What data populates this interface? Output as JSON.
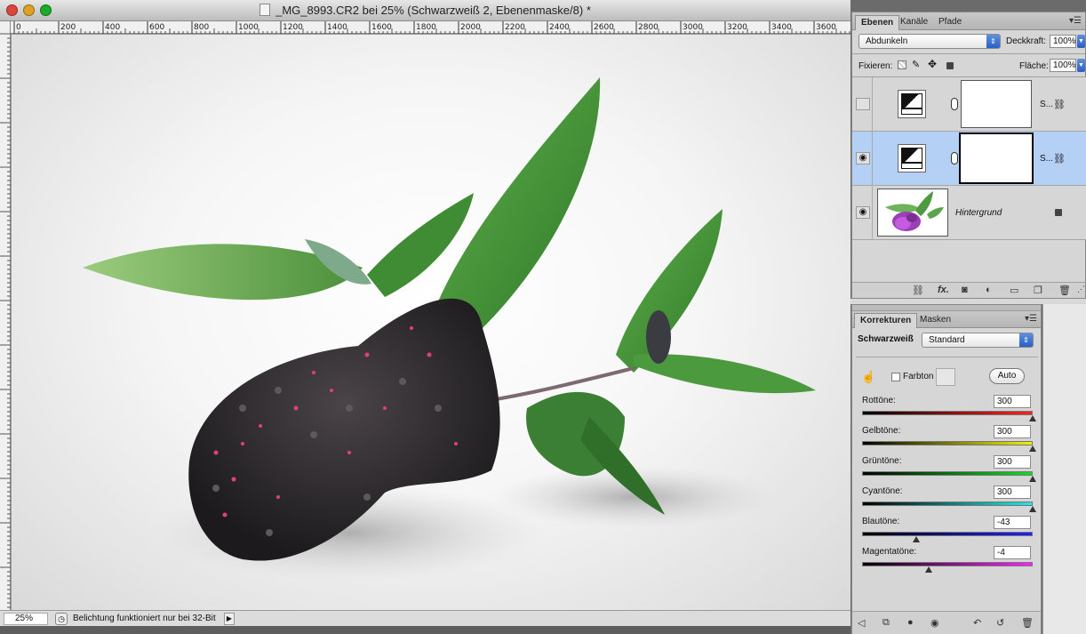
{
  "window": {
    "title": "_MG_8993.CR2 bei 25% (Schwarzweiß 2, Ebenenmaske/8) *",
    "traffic_light_colors": [
      "#e0443e",
      "#dea123",
      "#1aab29"
    ]
  },
  "ruler": {
    "h_labels": [
      "0",
      "200",
      "400",
      "600",
      "800",
      "1000",
      "1200",
      "1400",
      "1600",
      "1800",
      "2000",
      "2200",
      "2400",
      "2600",
      "2800",
      "3000",
      "3200",
      "3400",
      "3600"
    ]
  },
  "status": {
    "zoom": "25%",
    "text": "Belichtung funktioniert nur bei 32-Bit"
  },
  "layers_panel": {
    "tabs": [
      "Ebenen",
      "Kanäle",
      "Pfade"
    ],
    "blend_mode": "Abdunkeln",
    "opacity_label": "Deckkraft:",
    "opacity_value": "100%",
    "lock_label": "Fixieren:",
    "fill_label": "Fläche:",
    "fill_value": "100%",
    "layers": [
      {
        "name": "S...",
        "visible": false,
        "selected": false
      },
      {
        "name": "S...",
        "visible": true,
        "selected": true
      },
      {
        "name": "Hintergrund",
        "visible": true,
        "selected": false
      }
    ]
  },
  "adjustments_panel": {
    "tabs": [
      "Korrekturen",
      "Masken"
    ],
    "adjustment_name": "Schwarzweiß",
    "preset": "Standard",
    "tint_label": "Farbton",
    "auto_label": "Auto",
    "sliders": [
      {
        "label": "Rottöne:",
        "value": "300",
        "level": 1.0,
        "gradient": "#000000,#ff2020"
      },
      {
        "label": "Gelbtöne:",
        "value": "300",
        "level": 1.0,
        "gradient": "#000000,#f0f000"
      },
      {
        "label": "Grüntöne:",
        "value": "300",
        "level": 1.0,
        "gradient": "#000000,#10e020"
      },
      {
        "label": "Cyantöne:",
        "value": "300",
        "level": 1.0,
        "gradient": "#000000,#20e8e8"
      },
      {
        "label": "Blautöne:",
        "value": "-43",
        "level": 0.32,
        "gradient": "#000000,#2020ff"
      },
      {
        "label": "Magentatöne:",
        "value": "-4",
        "level": 0.39,
        "gradient": "#000000,#ff20ff"
      }
    ]
  }
}
